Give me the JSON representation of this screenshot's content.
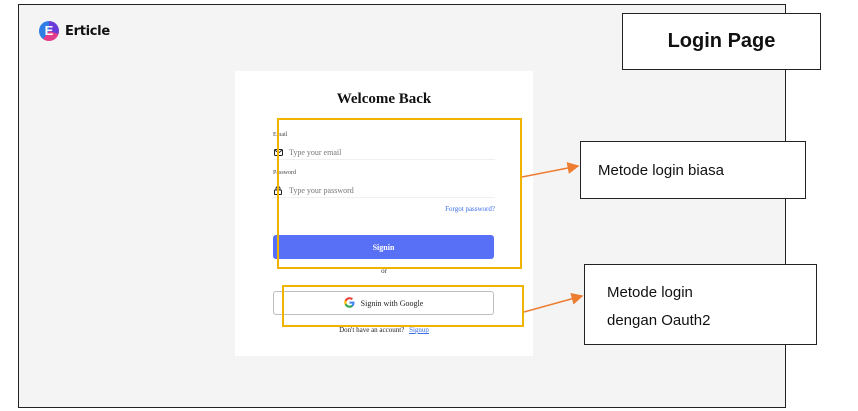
{
  "brand": {
    "name": "Erticle",
    "logo_icon": "erticle-logo-icon"
  },
  "login": {
    "title": "Welcome Back",
    "email": {
      "label": "Email",
      "placeholder": "Type your email",
      "icon": "mail-icon"
    },
    "password": {
      "label": "Password",
      "placeholder": "Type your password",
      "icon": "lock-icon"
    },
    "forgot_label": "Forgot password?",
    "signin_label": "Signin",
    "or_text": "or",
    "google_label": "Signin with Google",
    "signup_prompt": "Don't have an account?",
    "signup_link": "Signup"
  },
  "annotations": {
    "page_title": "Login Page",
    "classic_method": "Metode login biasa",
    "oauth_method_line1": "Metode login",
    "oauth_method_line2": "dengan Oauth2"
  },
  "colors": {
    "highlight": "#f0b400",
    "arrow": "#ed7d31",
    "signin_button": "#5870f6",
    "link": "#3a6fe8"
  }
}
